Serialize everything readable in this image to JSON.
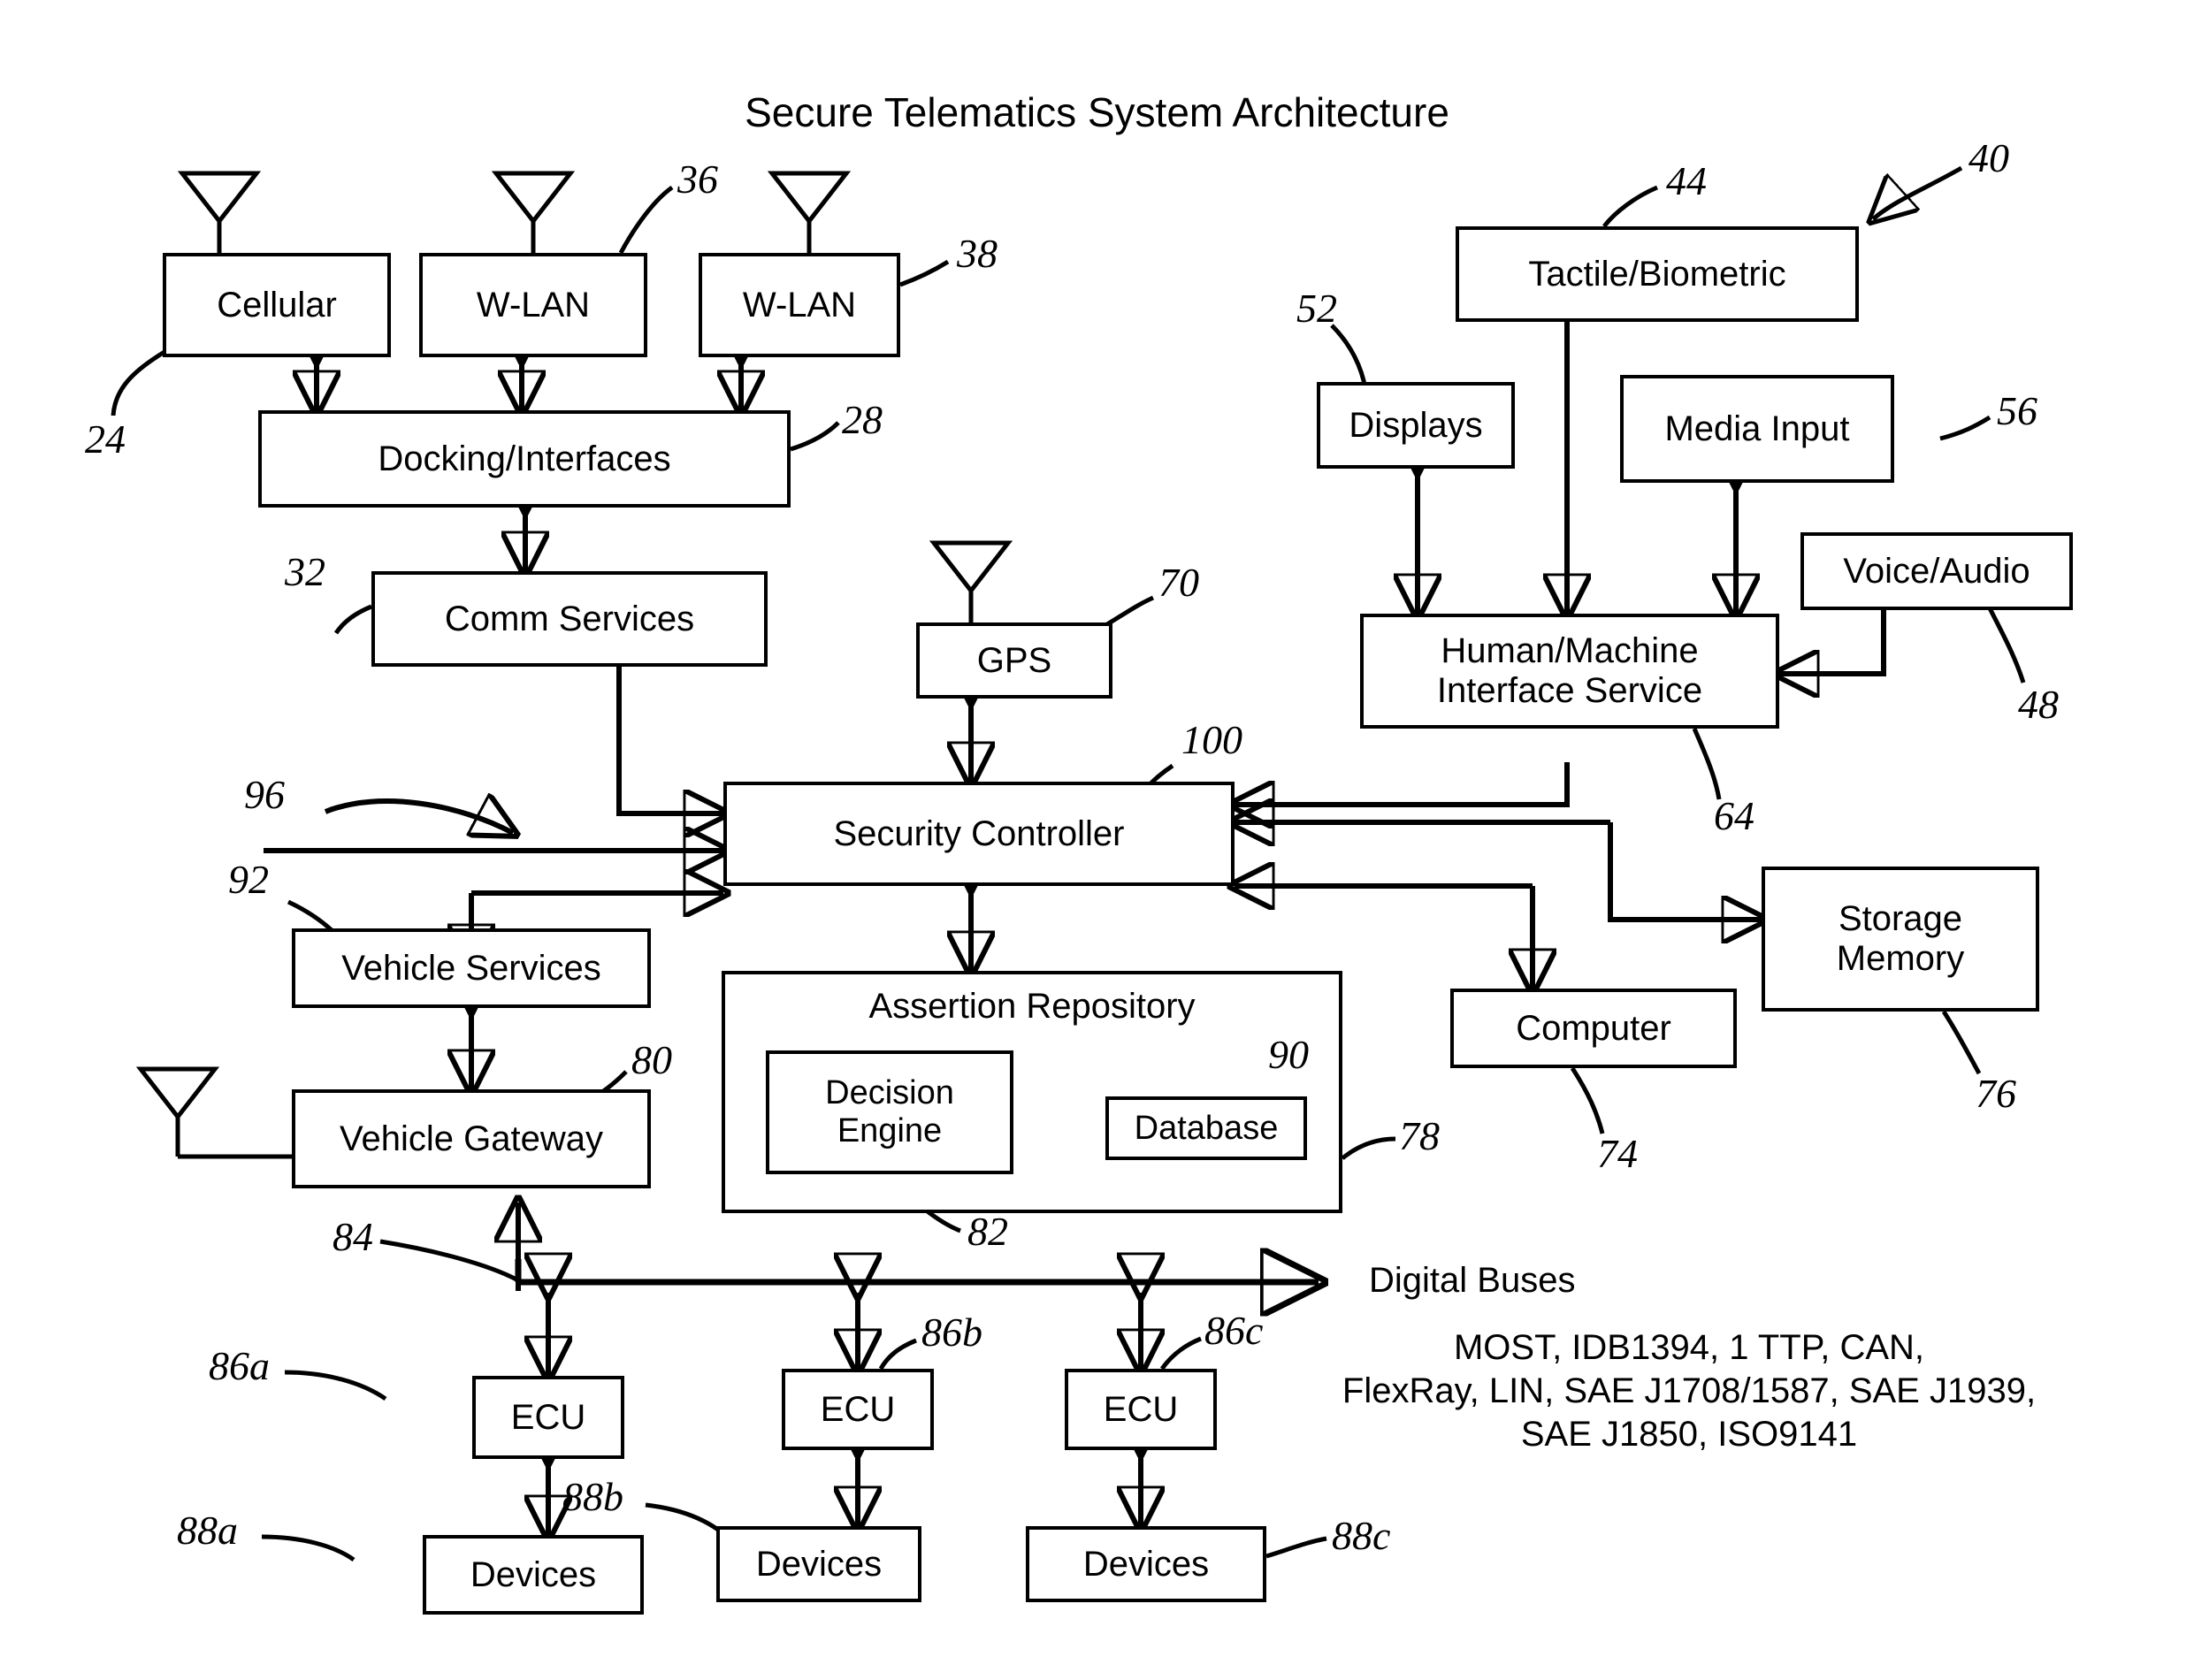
{
  "title": "Secure Telematics System Architecture",
  "boxes": {
    "cellular": "Cellular",
    "wlan1": "W-LAN",
    "wlan2": "W-LAN",
    "docking": "Docking/Interfaces",
    "comm_services": "Comm Services",
    "gps": "GPS",
    "tactile_biometric": "Tactile/Biometric",
    "displays": "Displays",
    "media_input": "Media Input",
    "voice_audio": "Voice/Audio",
    "hmi_service": "Human/Machine\nInterface Service",
    "security_controller": "Security Controller",
    "vehicle_services": "Vehicle Services",
    "vehicle_gateway": "Vehicle Gateway",
    "assertion_repository": "Assertion Repository",
    "decision_engine": "Decision\nEngine",
    "database": "Database",
    "computer": "Computer",
    "storage_memory": "Storage\nMemory",
    "ecu_a": "ECU",
    "ecu_b": "ECU",
    "ecu_c": "ECU",
    "devices_a": "Devices",
    "devices_b": "Devices",
    "devices_c": "Devices"
  },
  "reference_numerals": {
    "n24": "24",
    "n28": "28",
    "n32": "32",
    "n36": "36",
    "n38": "38",
    "n40": "40",
    "n44": "44",
    "n48": "48",
    "n52": "52",
    "n56": "56",
    "n64": "64",
    "n70": "70",
    "n74": "74",
    "n76": "76",
    "n78": "78",
    "n80": "80",
    "n82": "82",
    "n84": "84",
    "n86a": "86a",
    "n86b": "86b",
    "n86c": "86c",
    "n88a": "88a",
    "n88b": "88b",
    "n88c": "88c",
    "n90": "90",
    "n92": "92",
    "n96": "96",
    "n100": "100"
  },
  "digital_buses": {
    "heading": "Digital Buses",
    "list": "MOST, IDB1394, 1  TTP, CAN,\nFlexRay, LIN, SAE J1708/1587, SAE  J1939,\nSAE J1850, ISO9141"
  },
  "colors": {
    "ink": "#000000",
    "paper": "#ffffff"
  }
}
